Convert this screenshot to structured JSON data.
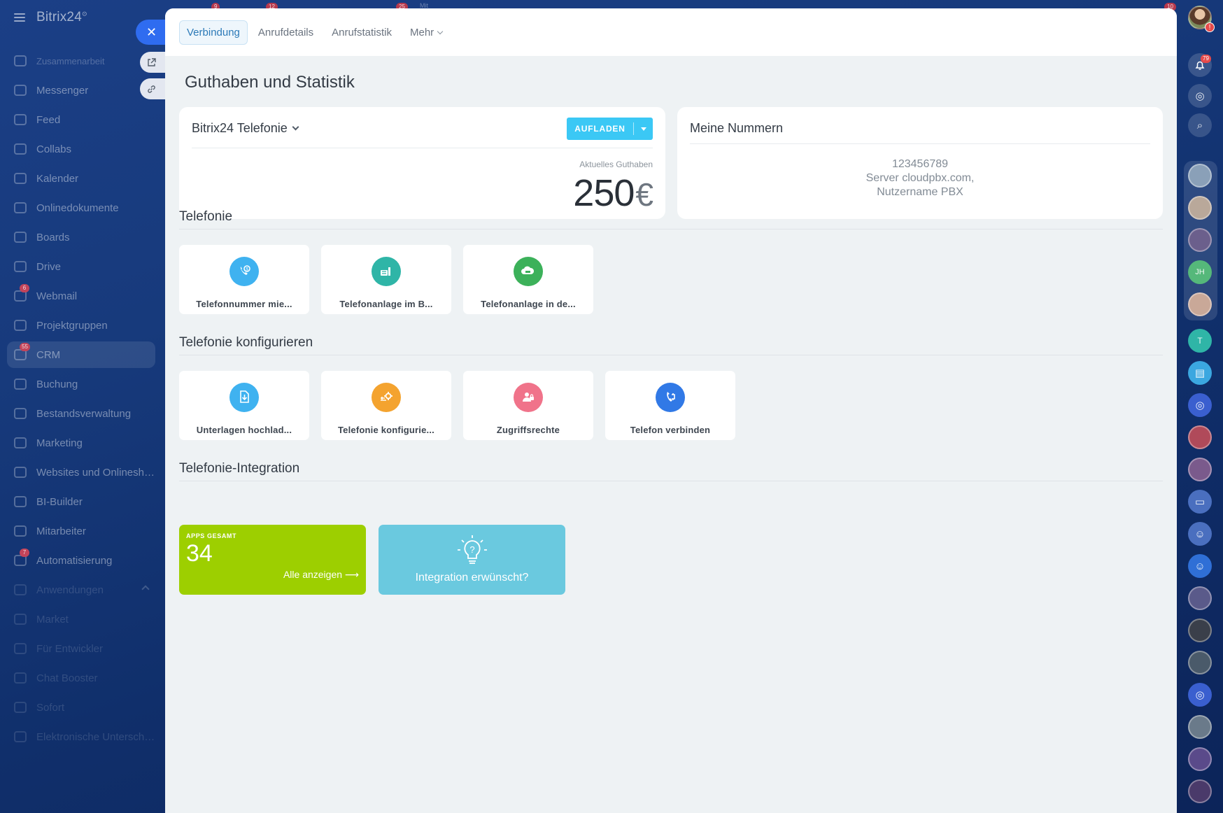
{
  "app": {
    "name": "Bitrix24"
  },
  "sidebar": {
    "items": [
      {
        "label": "Zusammenarbeit",
        "style": "tiny"
      },
      {
        "label": "Messenger"
      },
      {
        "label": "Feed"
      },
      {
        "label": "Collabs"
      },
      {
        "label": "Kalender"
      },
      {
        "label": "Onlinedokumente"
      },
      {
        "label": "Boards"
      },
      {
        "label": "Drive"
      },
      {
        "label": "Webmail",
        "badge": "6"
      },
      {
        "label": "Projektgruppen"
      },
      {
        "label": "CRM",
        "badge": "55",
        "active": true
      },
      {
        "label": "Buchung"
      },
      {
        "label": "Bestandsverwaltung"
      },
      {
        "label": "Marketing"
      },
      {
        "label": "Websites und Onlineshops"
      },
      {
        "label": "BI-Builder"
      },
      {
        "label": "Mitarbeiter"
      },
      {
        "label": "Automatisierung",
        "badge": "7"
      },
      {
        "label": "Anwendungen",
        "style": "faint",
        "chevron": true
      },
      {
        "label": "Market",
        "style": "faint"
      },
      {
        "label": "Für Entwickler",
        "style": "faint"
      },
      {
        "label": "Chat Booster",
        "style": "faint"
      },
      {
        "label": "Sofort",
        "style": "faint"
      },
      {
        "label": "Elektronische Unterschrift",
        "style": "faint"
      }
    ]
  },
  "header_badges": {
    "b1": "9",
    "b2": "12",
    "b3": "25",
    "b4": "10",
    "strip_text": "Mit"
  },
  "slider": {
    "close_label": "✕",
    "tabs": [
      {
        "label": "Verbindung",
        "active": true
      },
      {
        "label": "Anrufdetails"
      },
      {
        "label": "Anrufstatistik"
      },
      {
        "label": "Mehr",
        "dropdown": true
      }
    ],
    "title": "Guthaben und Statistik",
    "balance": {
      "title": "Bitrix24 Telefonie",
      "button_label": "AUFLADEN",
      "caption": "Aktuelles Guthaben",
      "amount": "250",
      "currency": "€"
    },
    "numbers": {
      "title": "Meine Nummern",
      "line1": "123456789",
      "line2": "Server cloudpbx.com,",
      "line3": "Nutzername PBX"
    },
    "sections": {
      "telefonie": {
        "title": "Telefonie",
        "tiles": [
          {
            "label": "Telefonnummer mie...",
            "icon": "phone-rent-icon",
            "color": "#3fb2f0"
          },
          {
            "label": "Telefonanlage im B...",
            "icon": "pbx-office-icon",
            "color": "#2fb5a7"
          },
          {
            "label": "Telefonanlage in de...",
            "icon": "pbx-cloud-icon",
            "color": "#3cb15a"
          }
        ]
      },
      "konfig": {
        "title": "Telefonie konfigurieren",
        "tiles": [
          {
            "label": "Unterlagen hochlad...",
            "icon": "document-upload-icon",
            "color": "#3fb2f0"
          },
          {
            "label": "Telefonie konfigurie...",
            "icon": "settings-gear-icon",
            "color": "#f4a32f"
          },
          {
            "label": "Zugriffsrechte",
            "icon": "access-rights-icon",
            "color": "#f0738a"
          },
          {
            "label": "Telefon verbinden",
            "icon": "phone-connect-icon",
            "color": "#3179e6"
          }
        ]
      },
      "integration": {
        "title": "Telefonie-Integration",
        "apps_caption": "APPS GESAMT",
        "apps_count": "34",
        "apps_link": "Alle anzeigen",
        "apps_color": "#9dcf00",
        "integration_label": "Integration erwünscht?",
        "integration_color": "#6ac9df"
      }
    }
  },
  "right_rail": {
    "notifications_badge": "79",
    "user_alert": "!",
    "initials": [
      "JH",
      "T"
    ]
  }
}
